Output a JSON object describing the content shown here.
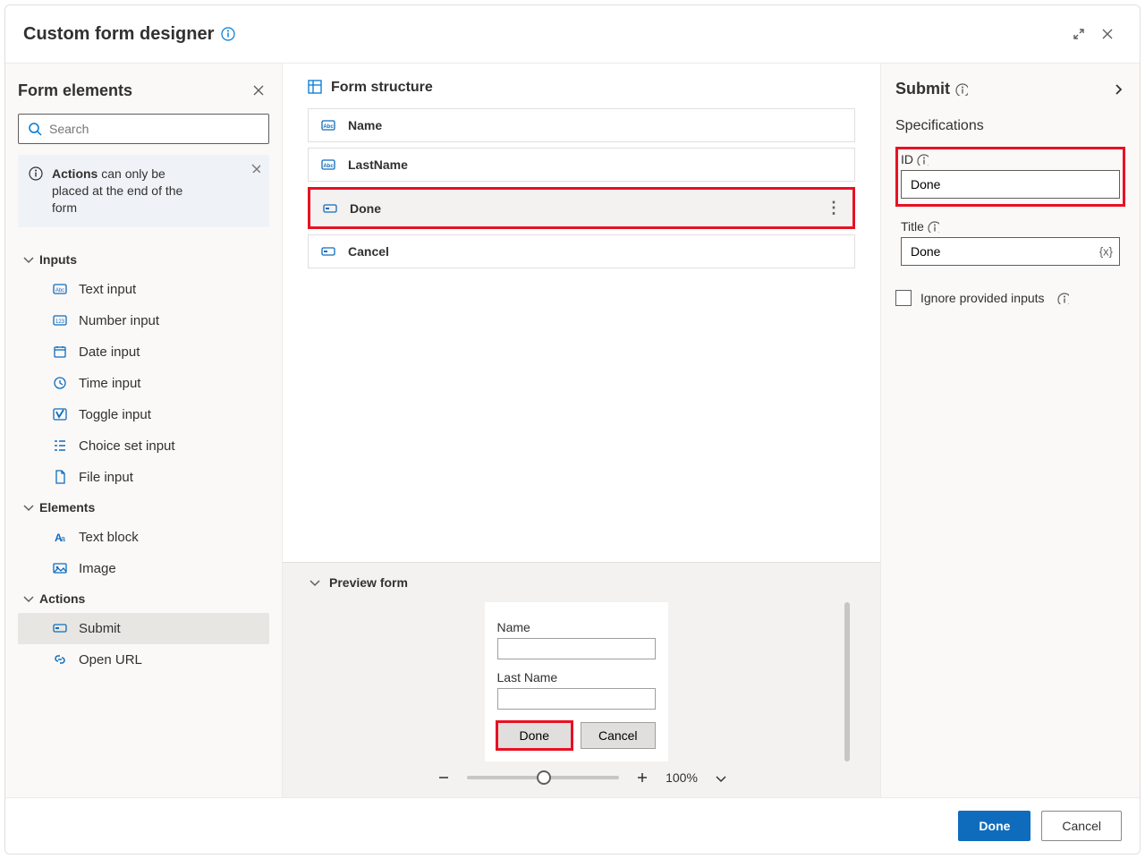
{
  "header": {
    "title": "Custom form designer"
  },
  "left": {
    "title": "Form elements",
    "search_placeholder": "Search",
    "notice_strong": "Actions",
    "notice_rest": " can only be placed at the end of the form",
    "groups": {
      "inputs": {
        "label": "Inputs",
        "items": [
          {
            "label": "Text input",
            "icon": "abc"
          },
          {
            "label": "Number input",
            "icon": "num"
          },
          {
            "label": "Date input",
            "icon": "date"
          },
          {
            "label": "Time input",
            "icon": "time"
          },
          {
            "label": "Toggle input",
            "icon": "toggle"
          },
          {
            "label": "Choice set input",
            "icon": "choice"
          },
          {
            "label": "File input",
            "icon": "file"
          }
        ]
      },
      "elements": {
        "label": "Elements",
        "items": [
          {
            "label": "Text block",
            "icon": "textblock"
          },
          {
            "label": "Image",
            "icon": "image"
          }
        ]
      },
      "actions": {
        "label": "Actions",
        "items": [
          {
            "label": "Submit",
            "icon": "submit",
            "selected": true
          },
          {
            "label": "Open URL",
            "icon": "link"
          }
        ]
      }
    }
  },
  "center": {
    "structure_title": "Form structure",
    "rows": [
      {
        "label": "Name",
        "icon": "abc"
      },
      {
        "label": "LastName",
        "icon": "abc"
      },
      {
        "label": "Done",
        "icon": "submit",
        "highlighted": true,
        "has_menu": true
      },
      {
        "label": "Cancel",
        "icon": "submit"
      }
    ],
    "preview": {
      "title": "Preview form",
      "fields": [
        {
          "label": "Name"
        },
        {
          "label": "Last Name"
        }
      ],
      "buttons": [
        {
          "label": "Done",
          "highlighted": true
        },
        {
          "label": "Cancel"
        }
      ],
      "zoom": "100%"
    }
  },
  "right": {
    "title": "Submit",
    "specs_title": "Specifications",
    "id_label": "ID",
    "id_value": "Done",
    "title_label": "Title",
    "title_value": "Done",
    "fx_symbol": "{x}",
    "ignore_label": "Ignore provided inputs"
  },
  "footer": {
    "done": "Done",
    "cancel": "Cancel"
  }
}
